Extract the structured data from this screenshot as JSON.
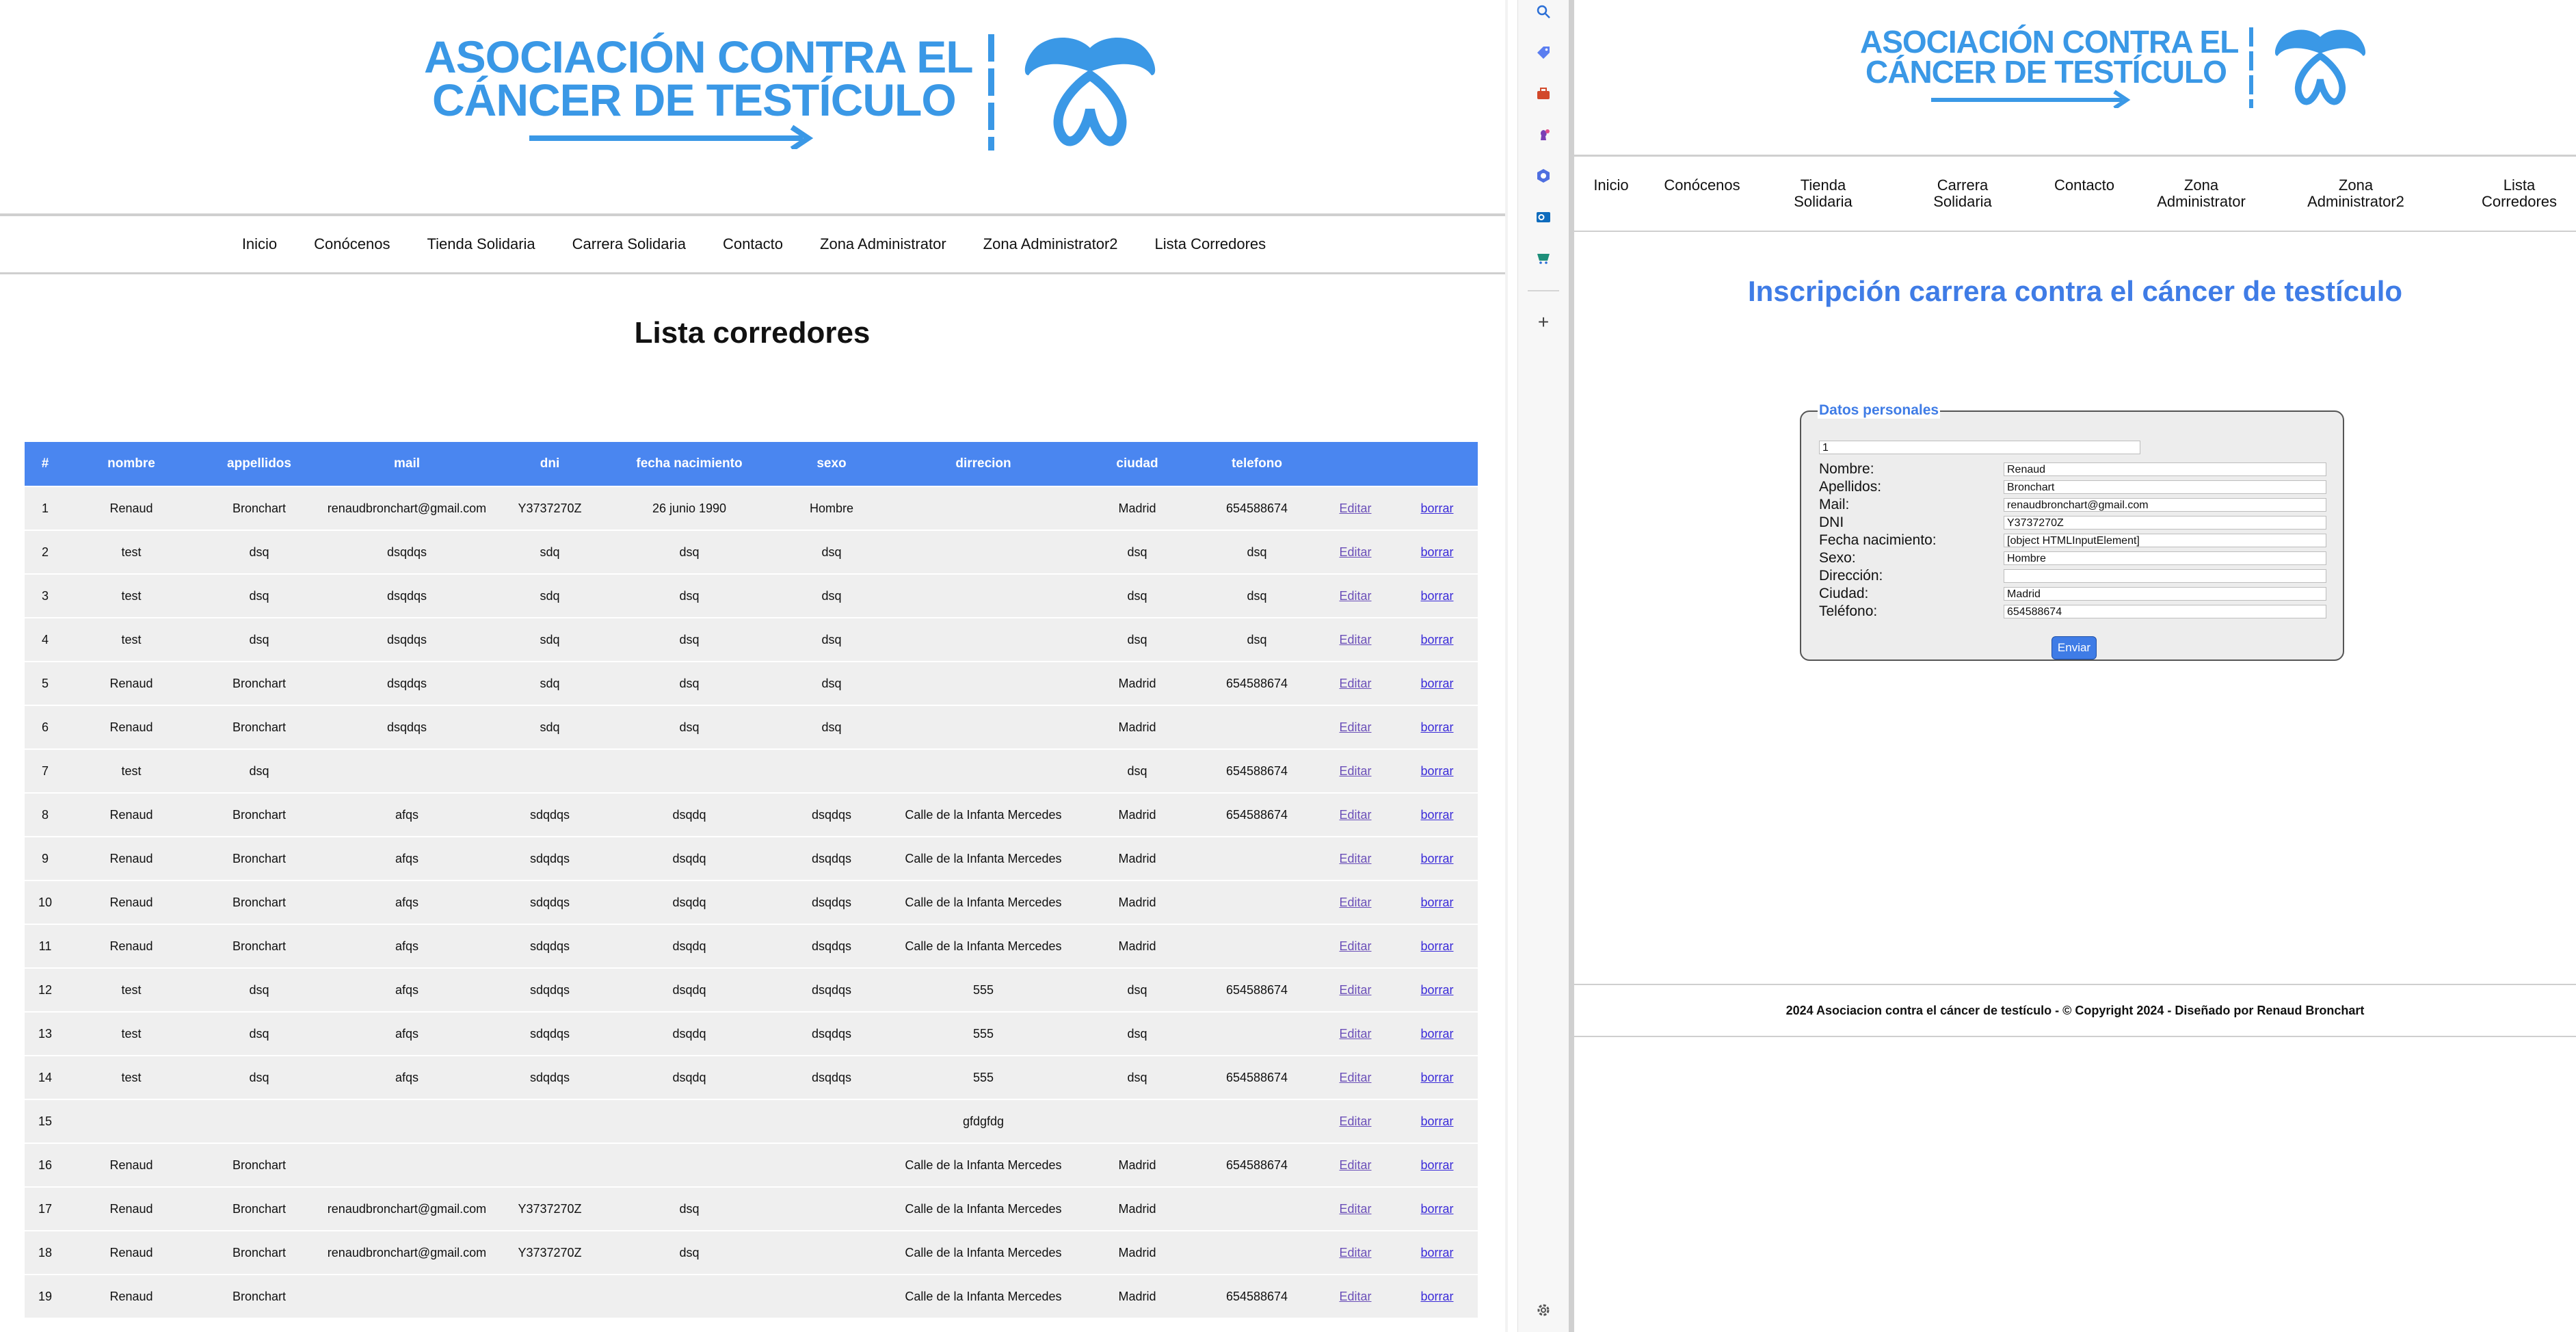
{
  "left": {
    "logo": {
      "line1": "ASOCIACIÓN CONTRA EL",
      "line2": "CÁNCER DE TESTÍCULO"
    },
    "nav": [
      "Inicio",
      "Conócenos",
      "Tienda Solidaria",
      "Carrera Solidaria",
      "Contacto",
      "Zona Administrator",
      "Zona Administrator2",
      "Lista Corredores"
    ],
    "title": "Lista corredores",
    "table": {
      "headers": [
        "#",
        "nombre",
        "appellidos",
        "mail",
        "dni",
        "fecha nacimiento",
        "sexo",
        "dirrecion",
        "ciudad",
        "telefono",
        "",
        ""
      ],
      "edit_label": "Editar",
      "delete_label": "borrar",
      "rows": [
        [
          "1",
          "Renaud",
          "Bronchart",
          "renaudbronchart@gmail.com",
          "Y3737270Z",
          "26 junio 1990",
          "Hombre",
          "",
          "Madrid",
          "654588674"
        ],
        [
          "2",
          "test",
          "dsq",
          "dsqdqs",
          "sdq",
          "dsq",
          "dsq",
          "",
          "dsq",
          "dsq"
        ],
        [
          "3",
          "test",
          "dsq",
          "dsqdqs",
          "sdq",
          "dsq",
          "dsq",
          "",
          "dsq",
          "dsq"
        ],
        [
          "4",
          "test",
          "dsq",
          "dsqdqs",
          "sdq",
          "dsq",
          "dsq",
          "",
          "dsq",
          "dsq"
        ],
        [
          "5",
          "Renaud",
          "Bronchart",
          "dsqdqs",
          "sdq",
          "dsq",
          "dsq",
          "",
          "Madrid",
          "654588674"
        ],
        [
          "6",
          "Renaud",
          "Bronchart",
          "dsqdqs",
          "sdq",
          "dsq",
          "dsq",
          "",
          "Madrid",
          ""
        ],
        [
          "7",
          "test",
          "dsq",
          "",
          "",
          "",
          "",
          "",
          "dsq",
          "654588674"
        ],
        [
          "8",
          "Renaud",
          "Bronchart",
          "afqs",
          "sdqdqs",
          "dsqdq",
          "dsqdqs",
          "Calle de la Infanta Mercedes",
          "Madrid",
          "654588674"
        ],
        [
          "9",
          "Renaud",
          "Bronchart",
          "afqs",
          "sdqdqs",
          "dsqdq",
          "dsqdqs",
          "Calle de la Infanta Mercedes",
          "Madrid",
          ""
        ],
        [
          "10",
          "Renaud",
          "Bronchart",
          "afqs",
          "sdqdqs",
          "dsqdq",
          "dsqdqs",
          "Calle de la Infanta Mercedes",
          "Madrid",
          ""
        ],
        [
          "11",
          "Renaud",
          "Bronchart",
          "afqs",
          "sdqdqs",
          "dsqdq",
          "dsqdqs",
          "Calle de la Infanta Mercedes",
          "Madrid",
          ""
        ],
        [
          "12",
          "test",
          "dsq",
          "afqs",
          "sdqdqs",
          "dsqdq",
          "dsqdqs",
          "555",
          "dsq",
          "654588674"
        ],
        [
          "13",
          "test",
          "dsq",
          "afqs",
          "sdqdqs",
          "dsqdq",
          "dsqdqs",
          "555",
          "dsq",
          ""
        ],
        [
          "14",
          "test",
          "dsq",
          "afqs",
          "sdqdqs",
          "dsqdq",
          "dsqdqs",
          "555",
          "dsq",
          "654588674"
        ],
        [
          "15",
          "",
          "",
          "",
          "",
          "",
          "",
          "gfdgfdg",
          "",
          ""
        ],
        [
          "16",
          "Renaud",
          "Bronchart",
          "",
          "",
          "",
          "",
          "Calle de la Infanta Mercedes",
          "Madrid",
          "654588674"
        ],
        [
          "17",
          "Renaud",
          "Bronchart",
          "renaudbronchart@gmail.com",
          "Y3737270Z",
          "dsq",
          "",
          "Calle de la Infanta Mercedes",
          "Madrid",
          ""
        ],
        [
          "18",
          "Renaud",
          "Bronchart",
          "renaudbronchart@gmail.com",
          "Y3737270Z",
          "dsq",
          "",
          "Calle de la Infanta Mercedes",
          "Madrid",
          ""
        ],
        [
          "19",
          "Renaud",
          "Bronchart",
          "",
          "",
          "",
          "",
          "Calle de la Infanta Mercedes",
          "Madrid",
          "654588674"
        ]
      ]
    }
  },
  "sidebar": {
    "icons": [
      "search-icon",
      "tag-icon",
      "toolbox-icon",
      "chess-icon",
      "copilot-icon",
      "outlook-icon",
      "shopping-icon",
      "add-icon",
      "settings-icon"
    ]
  },
  "right": {
    "logo": {
      "line1": "ASOCIACIÓN CONTRA EL",
      "line2": "CÁNCER DE TESTÍCULO"
    },
    "nav": [
      "Inicio",
      "Conócenos",
      "Tienda Solidaria",
      "Carrera Solidaria",
      "Contacto",
      "Zona Administrator",
      "Zona Administrator2",
      "Lista Corredores"
    ],
    "title": "Inscripción carrera contra el cáncer de testículo",
    "form": {
      "legend": "Datos personales",
      "id_value": "1",
      "fields": [
        {
          "label": "Nombre:",
          "value": "Renaud"
        },
        {
          "label": "Apellidos:",
          "value": "Bronchart"
        },
        {
          "label": "Mail:",
          "value": "renaudbronchart@gmail.com"
        },
        {
          "label": "DNI",
          "value": "Y3737270Z"
        },
        {
          "label": "Fecha nacimiento:",
          "value": "[object HTMLInputElement]"
        },
        {
          "label": "Sexo:",
          "value": "Hombre"
        },
        {
          "label": "Dirección:",
          "value": ""
        },
        {
          "label": "Ciudad:",
          "value": "Madrid"
        },
        {
          "label": "Teléfono:",
          "value": "654588674"
        }
      ],
      "submit": "Enviar"
    },
    "footer": "2024 Asociacion contra el cáncer de testículo - © Copyright 2024 - Diseñado por Renaud Bronchart"
  },
  "colors": {
    "accent": "#4a86f0",
    "logo": "#3a98e6",
    "title_blue": "#3f7ce6"
  }
}
